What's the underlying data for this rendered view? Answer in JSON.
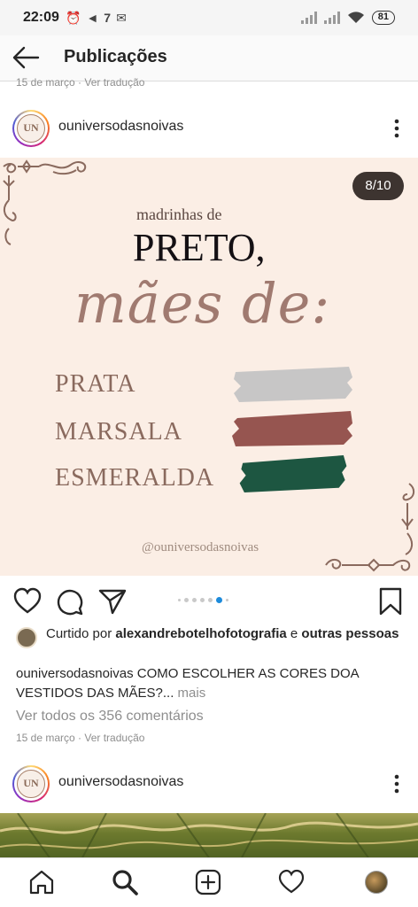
{
  "status_bar": {
    "time": "22:09",
    "left_icons": [
      "alarm-icon",
      "telegram-icon",
      "seven-icon",
      "gmail-icon"
    ],
    "right_icons": [
      "signal-icon",
      "signal-icon",
      "wifi-icon"
    ],
    "battery": "81"
  },
  "header": {
    "back_icon": "arrow-left-icon",
    "title": "Publicações"
  },
  "previous_post": {
    "caption_fragment": "15 de março · Ver tradução"
  },
  "post": {
    "username": "ouniversodasnoivas",
    "avatar_initials": "UN",
    "counter": "8/10",
    "image_text": {
      "line1": "madrinhas de",
      "line2": "PRETO,",
      "line3": "mães de:",
      "colors": [
        {
          "label": "PRATA",
          "swatch": "#c7c6c6"
        },
        {
          "label": "MARSALA",
          "swatch": "#965550"
        },
        {
          "label": "ESMERALDA",
          "swatch": "#1d5641"
        }
      ],
      "handle": "@ouniversodasnoivas"
    },
    "carousel": {
      "total": 10,
      "active": 8
    },
    "likes": {
      "prefix": "Curtido por ",
      "user": "alexandrebotelhofotografia",
      "joiner": " e ",
      "others": "outras pessoas"
    },
    "caption": {
      "user": "ouniversodasnoivas",
      "text": " COMO ESCOLHER AS CORES DOA VESTIDOS DAS MÃES?...",
      "more": " mais"
    },
    "comments_link": "Ver todos os 356 comentários",
    "date": "15 de março · Ver tradução"
  },
  "next_post": {
    "username": "ouniversodasnoivas",
    "avatar_initials": "UN"
  },
  "bottom_nav": {
    "items": [
      "home-icon",
      "search-icon",
      "new-post-icon",
      "activity-heart-icon",
      "profile-avatar"
    ]
  },
  "colors": {
    "image_bg": "#fbeee5",
    "accent_blue": "#1d8bdb",
    "flourish": "#8a6a5e"
  }
}
